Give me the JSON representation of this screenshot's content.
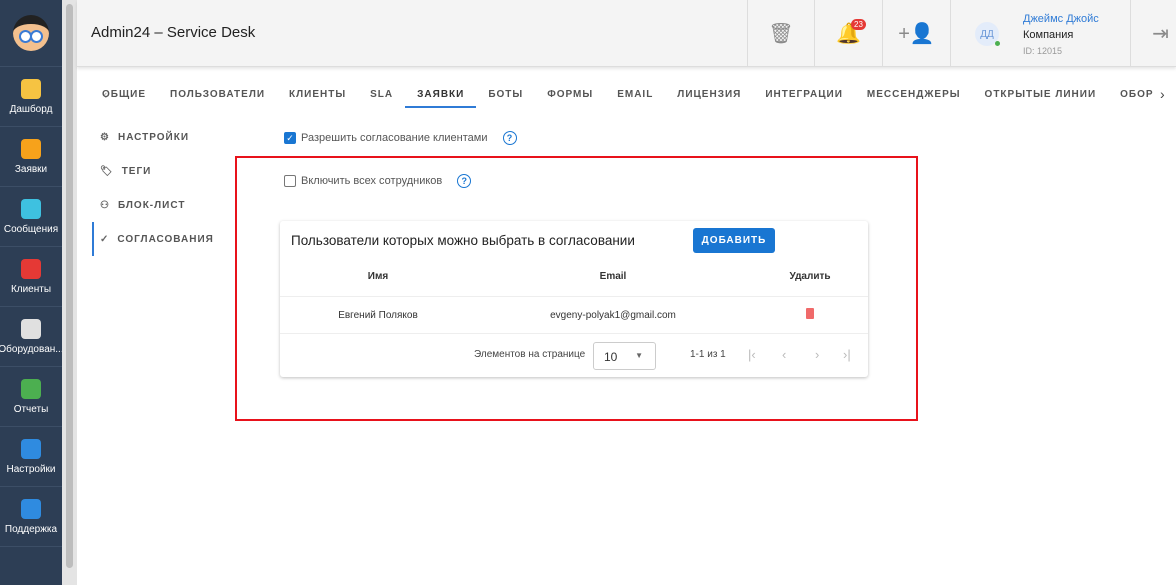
{
  "sidebar": {
    "items": [
      {
        "label": "Дашборд",
        "color": "#f6c342"
      },
      {
        "label": "Заявки",
        "color": "#f7a21b"
      },
      {
        "label": "Сообщения",
        "color": "#3ec1e0"
      },
      {
        "label": "Клиенты",
        "color": "#e53935"
      },
      {
        "label": "Оборудован...",
        "color": "#e0e0e0"
      },
      {
        "label": "Отчеты",
        "color": "#4caf50"
      },
      {
        "label": "Настройки",
        "color": "#2f8be0"
      },
      {
        "label": "Поддержка",
        "color": "#2f8be0"
      }
    ]
  },
  "header": {
    "title": "Admin24 – Service Desk",
    "notifications": "23",
    "user": {
      "initials": "ДД",
      "name": "Джеймс Джойс",
      "company": "Компания",
      "id": "ID: 12015"
    }
  },
  "tabs": [
    "ОБЩИЕ",
    "ПОЛЬЗОВАТЕЛИ",
    "КЛИЕНТЫ",
    "SLA",
    "ЗАЯВКИ",
    "БОТЫ",
    "ФОРМЫ",
    "EMAIL",
    "ЛИЦЕНЗИЯ",
    "ИНТЕГРАЦИИ",
    "МЕССЕНДЖЕРЫ",
    "ОТКРЫТЫЕ ЛИНИИ",
    "ОБОР"
  ],
  "subnav": [
    "НАСТРОЙКИ",
    "ТЕГИ",
    "БЛОК-ЛИСТ",
    "СОГЛАСОВАНИЯ"
  ],
  "options": {
    "allow_clients": "Разрешить согласование клиентами",
    "include_all": "Включить всех сотрудников"
  },
  "card": {
    "title": "Пользователи которых можно выбрать в согласовании",
    "add": "ДОБАВИТЬ",
    "columns": [
      "Имя",
      "Email",
      "Удалить"
    ],
    "rows": [
      {
        "name": "Евгений Поляков",
        "email": "evgeny-polyak1@gmail.com"
      }
    ],
    "per_page_label": "Элементов на странице",
    "per_page": "10",
    "range": "1-1 из 1"
  }
}
